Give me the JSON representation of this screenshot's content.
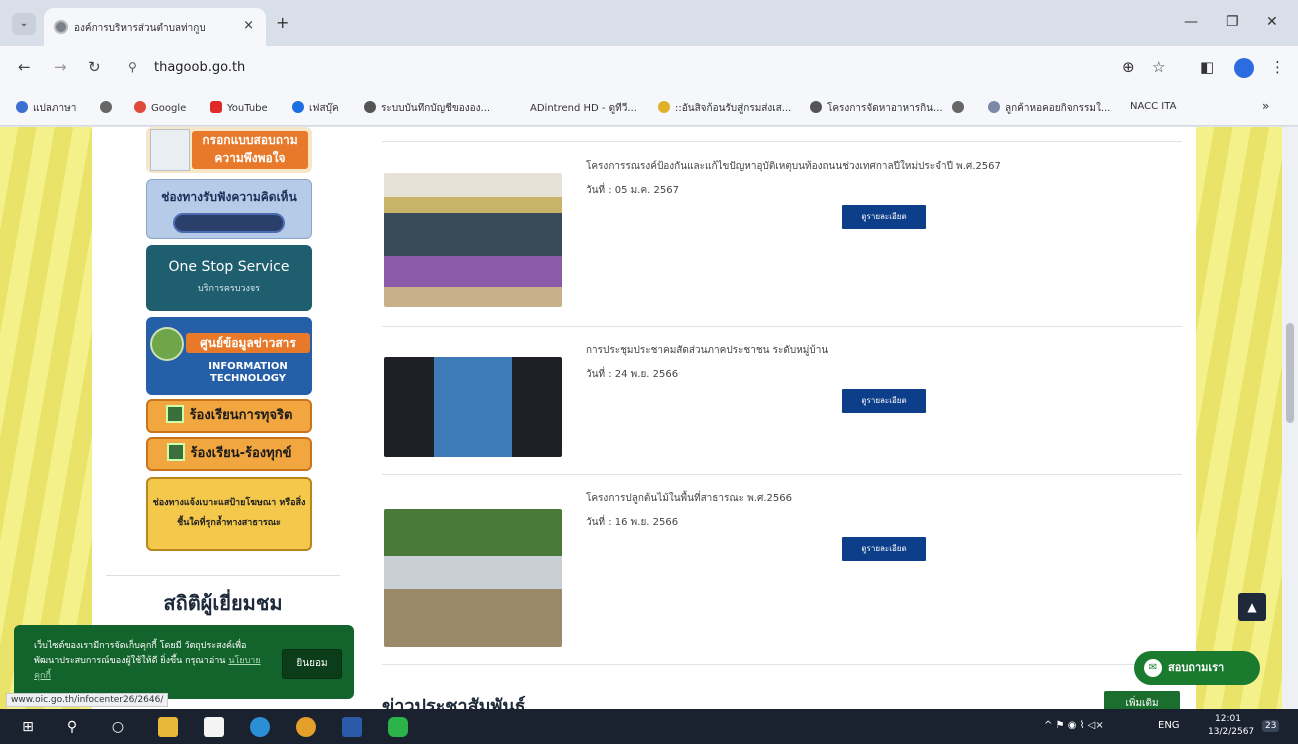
{
  "tab": {
    "title": "องค์การบริหารส่วนตำบลท่ากูบ",
    "close": "×",
    "new_tab": "+"
  },
  "window": {
    "minimize": "—",
    "maximize": "❐",
    "close": "✕",
    "dropdown": "⌄"
  },
  "toolbar": {
    "back": "←",
    "forward": "→",
    "reload": "↻",
    "site_info": "⚲",
    "url": "thagoob.go.th",
    "zoom": "⊕",
    "star": "☆",
    "sidepanel": "◧",
    "menu": "⋮"
  },
  "bookmarks": [
    {
      "label": "แปลภาษา",
      "color": "#3b6fd1"
    },
    {
      "label": "",
      "color": "#666666"
    },
    {
      "label": "Google",
      "color": "#e04a3a"
    },
    {
      "label": "YouTube",
      "color": "#e02a2a"
    },
    {
      "label": "เฟสบุ๊ค",
      "color": "#1b6fe0"
    },
    {
      "label": "ระบบบันทึกบัญชีขององ...",
      "color": "#555555"
    },
    {
      "label": "ADintrend HD - ดูทีวี...",
      "color": "#ffffff"
    },
    {
      "label": "::อันสิจก้อนรับสู่กรมส่งเส...",
      "color": "#e0b22a"
    },
    {
      "label": "โครงการจัดหาอาหารกิน...",
      "color": "#555555"
    },
    {
      "label": "",
      "color": "#666666"
    },
    {
      "label": "ลูกค้าหอคอยกิจกรรมใ...",
      "color": "#7b88a8"
    },
    {
      "label": "NACC ITA",
      "color": "#2a3f8a"
    }
  ],
  "bookmarks_more": "»",
  "sidebar": {
    "banner1": "กรอกแบบสอบถาม ความพึงพอใจ",
    "banner2": "ช่องทางรับฟังความคิดเห็น",
    "banner3_title": "One Stop Service",
    "banner3_sub": "บริการครบวงจร",
    "banner4_title": "ศูนย์ข้อมูลข่าวสาร",
    "banner4_sub": "INFORMATION TECHNOLOGY",
    "banner5": "ร้องเรียนการทุจริต",
    "banner6": "ร้องเรียน-ร้องทุกข์",
    "banner7": "ช่องทางแจ้งเบาะแสป้ายโฆษณา หรือสิ่งชื้นใดที่รุกล้ำทางสาธารณะ",
    "stats_heading": "สถิติผู้เยี่ยมชม"
  },
  "news": [
    {
      "title": "โครงการรณรงค์ป้องกันและแก้ไขปัญหาอุบัติเหตุบนท้องถนนช่วงเทศกาลปีใหม่ประจำปี พ.ศ.2567",
      "date": "วันที่ : 05 ม.ค. 2567",
      "button": "ดูรายละเอียด"
    },
    {
      "title": "การประชุมประชาคมสัดส่วนภาคประชาชน ระดับหมู่บ้าน",
      "date": "วันที่ : 24 พ.ย. 2566",
      "button": "ดูรายละเอียด"
    },
    {
      "title": "โครงการปลูกต้นไม้ในพื้นที่สาธารณะ พ.ศ.2566",
      "date": "วันที่ : 16 พ.ย. 2566",
      "button": "ดูรายละเอียด"
    }
  ],
  "section_heading": "ข่าวประชาสัมพันธ์",
  "more_button": "เพิ่มเติม",
  "cookie": {
    "message": "เว็บไซต์ของเรามีการจัดเก็บคุกกี้ โดยมี วัตถุประสงค์เพื่อพัฒนาประสบการณ์ของผู้ใช้ให้ดี ยิ่งขึ้น กรุณาอ่าน",
    "link": "นโยบายคุกกี้",
    "accept": "ยินยอม"
  },
  "status_url": "www.oic.go.th/infocenter26/2646/",
  "back_to_top": "▲",
  "messenger": "สอบถามเรา",
  "taskbar": {
    "start": "⊞",
    "search": "⚲",
    "cortana": "○",
    "tray_lang": "ENG",
    "tray_icons": "^ ⚑ ◉ ⌇ ◁×",
    "time": "12:01",
    "date": "13/2/2567",
    "notif": "23"
  }
}
